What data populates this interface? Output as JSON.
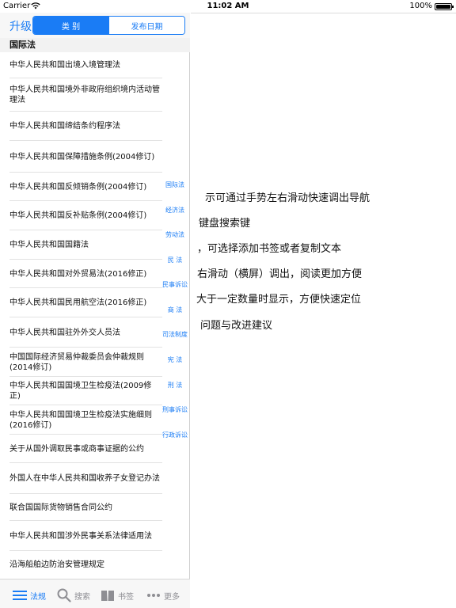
{
  "status_bar": {
    "carrier": "Carrier",
    "time": "11:02 AM",
    "battery": "100%"
  },
  "navbar": {
    "upgrade": "升级",
    "segments": [
      {
        "label": "类 别",
        "active": true
      },
      {
        "label": "发布日期",
        "active": false
      }
    ]
  },
  "section": {
    "header": "国际法"
  },
  "list_items": [
    "中华人民共和国出境入境管理法",
    "中华人民共和国境外非政府组织境内活动管理法",
    "中华人民共和国缔结条约程序法",
    "中华人民共和国保障措施条例(2004修订)",
    "中华人民共和国反倾销条例(2004修订)",
    "中华人民共和国反补贴条例(2004修订)",
    "中华人民共和国国籍法",
    "中华人民共和国对外贸易法(2016修正)",
    "中华人民共和国民用航空法(2016修正)",
    "中华人民共和国驻外外交人员法",
    "中国国际经济贸易仲裁委员会仲裁规则(2014修订)",
    "中华人民共和国国境卫生检疫法(2009修正)",
    "中华人民共和国国境卫生检疫法实施细则(2016修订)",
    "关于从国外调取民事或商事证据的公约",
    "外国人在中华人民共和国收养子女登记办法",
    "联合国国际货物销售合同公约",
    "中华人民共和国涉外民事关系法律适用法",
    "沿海船舶边防治安管理规定"
  ],
  "index": [
    "国际法",
    "经济法",
    "劳动法",
    "民 法",
    "民事诉讼",
    "商 法",
    "司法制度",
    "宪 法",
    "刑 法",
    "刑事诉讼",
    "行政诉讼"
  ],
  "tab_bar": {
    "tabs": [
      {
        "label": "法规",
        "icon": "list-icon",
        "active": true
      },
      {
        "label": "搜索",
        "icon": "search-icon",
        "active": false
      },
      {
        "label": "书签",
        "icon": "book-icon",
        "active": false
      },
      {
        "label": "更多",
        "icon": "more-icon",
        "active": false
      }
    ]
  },
  "content": {
    "help_lines": [
      "示可通过手势左右滑动快速调出导航",
      "键盘搜索键",
      "，可选择添加书签或者复制文本",
      "右滑动（横屏）调出，阅读更加方便",
      "大于一定数量时显示，方便快速定位",
      "问题与改进建议"
    ]
  },
  "colors": {
    "accent": "#1a7cf5",
    "tab_inactive": "#8e8e93"
  }
}
